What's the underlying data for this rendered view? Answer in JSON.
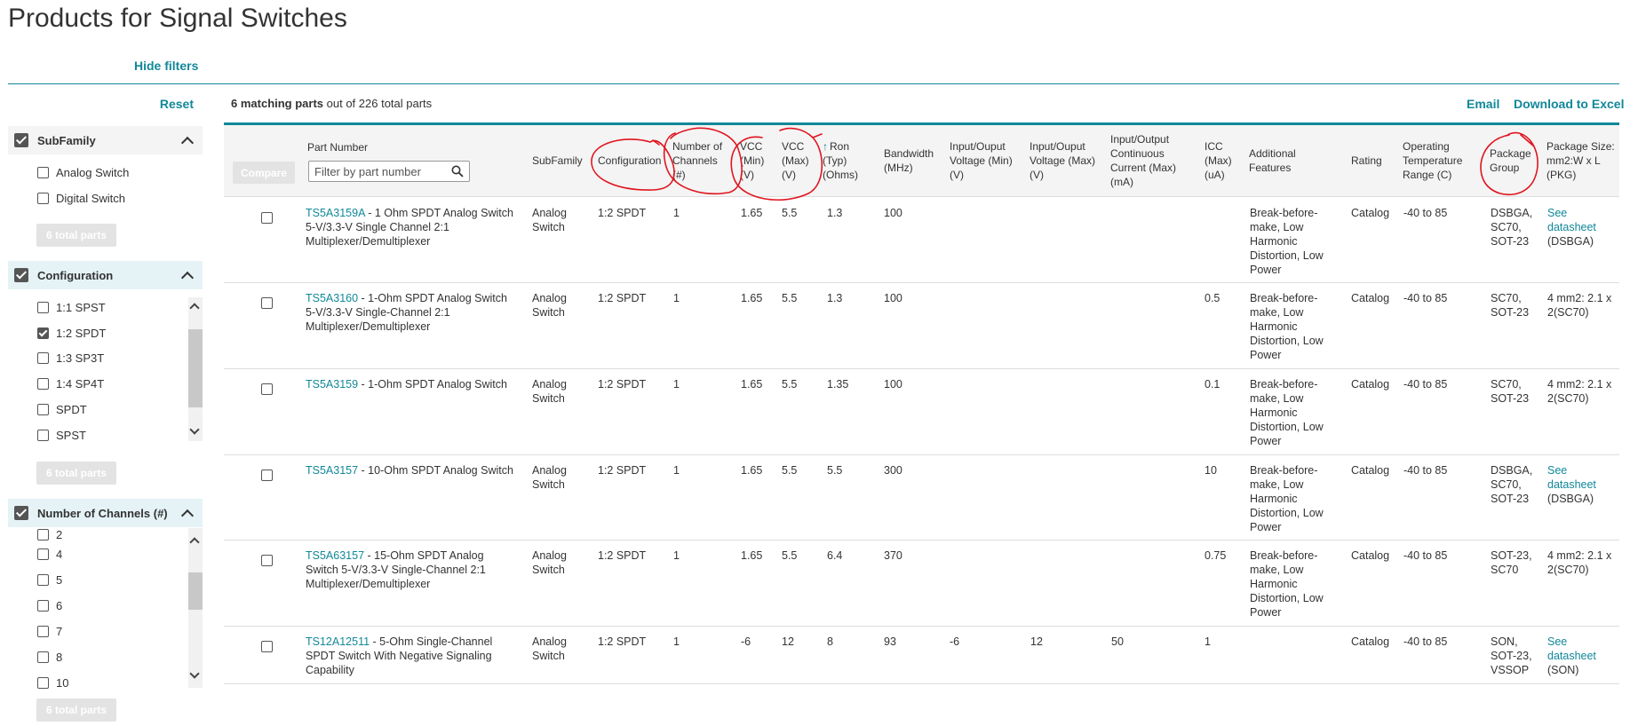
{
  "page": {
    "title": "Products for Signal Switches",
    "hide_filters": "Hide filters"
  },
  "sidebar": {
    "reset": "Reset",
    "total_parts": "6 total parts",
    "facets": [
      {
        "title": "SubFamily",
        "options": [
          {
            "label": "Analog Switch",
            "checked": false
          },
          {
            "label": "Digital Switch",
            "checked": false
          }
        ]
      },
      {
        "title": "Configuration",
        "options": [
          {
            "label": "1:1 SPST",
            "checked": false
          },
          {
            "label": "1:2 SPDT",
            "checked": true
          },
          {
            "label": "1:3 SP3T",
            "checked": false
          },
          {
            "label": "1:4 SP4T",
            "checked": false
          },
          {
            "label": "SPDT",
            "checked": false
          },
          {
            "label": "SPST",
            "checked": false
          }
        ]
      },
      {
        "title": "Number of Channels (#)",
        "options": [
          {
            "label": "2",
            "checked": false
          },
          {
            "label": "4",
            "checked": false
          },
          {
            "label": "5",
            "checked": false
          },
          {
            "label": "6",
            "checked": false
          },
          {
            "label": "7",
            "checked": false
          },
          {
            "label": "8",
            "checked": false
          },
          {
            "label": "10",
            "checked": false
          }
        ]
      }
    ]
  },
  "results": {
    "matching_bold": "6 matching parts",
    "matching_rest": " out of 226 total parts",
    "email": "Email",
    "download": "Download to Excel",
    "compare": "Compare",
    "filter_placeholder": "Filter by part number"
  },
  "table": {
    "headers": {
      "part_number": "Part Number",
      "subfamily": "SubFamily",
      "configuration": "Configuration",
      "channels": "Number of Channels (#)",
      "vcc_min": "VCC (Min) (V)",
      "vcc_max": "VCC (Max) (V)",
      "ron": "Ron (Typ) (Ohms)",
      "bandwidth": "Bandwidth (MHz)",
      "io_vmin": "Input/Ouput Voltage (Min) (V)",
      "io_vmax": "Input/Ouput Voltage (Max) (V)",
      "io_current": "Input/Output Continuous Current (Max) (mA)",
      "icc": "ICC (Max) (uA)",
      "features": "Additional Features",
      "rating": "Rating",
      "temp": "Operating Temperature Range (C)",
      "package_group": "Package Group",
      "package_size": "Package Size: mm2:W x L (PKG)"
    },
    "rows": [
      {
        "part": "TS5A3159A",
        "desc": " - 1 Ohm SPDT Analog Switch 5-V/3.3-V Single Channel 2:1 Multiplexer/Demultiplexer",
        "subfamily": "Analog Switch",
        "config": "1:2 SPDT",
        "channels": "1",
        "vcc_min": "1.65",
        "vcc_max": "5.5",
        "ron": "1.3",
        "bw": "100",
        "io_vmin": "",
        "io_vmax": "",
        "io_cur": "",
        "icc": "",
        "features": "Break-before-make, Low Harmonic Distortion, Low Power",
        "rating": "Catalog",
        "temp": "-40 to 85",
        "pkg_group": "DSBGA, SC70, SOT-23",
        "pkg_size_link": "See datasheet",
        "pkg_size_text": "(DSBGA)"
      },
      {
        "part": "TS5A3160",
        "desc": " - 1-Ohm SPDT Analog Switch 5-V/3.3-V Single-Channel 2:1 Multiplexer/Demultiplexer",
        "subfamily": "Analog Switch",
        "config": "1:2 SPDT",
        "channels": "1",
        "vcc_min": "1.65",
        "vcc_max": "5.5",
        "ron": "1.3",
        "bw": "100",
        "io_vmin": "",
        "io_vmax": "",
        "io_cur": "",
        "icc": "0.5",
        "features": "Break-before-make, Low Harmonic Distortion, Low Power",
        "rating": "Catalog",
        "temp": "-40 to 85",
        "pkg_group": "SC70, SOT-23",
        "pkg_size_link": "",
        "pkg_size_text": "4 mm2: 2.1 x 2(SC70)"
      },
      {
        "part": "TS5A3159",
        "desc": " - 1-Ohm SPDT Analog Switch",
        "subfamily": "Analog Switch",
        "config": "1:2 SPDT",
        "channels": "1",
        "vcc_min": "1.65",
        "vcc_max": "5.5",
        "ron": "1.35",
        "bw": "100",
        "io_vmin": "",
        "io_vmax": "",
        "io_cur": "",
        "icc": "0.1",
        "features": "Break-before-make, Low Harmonic Distortion, Low Power",
        "rating": "Catalog",
        "temp": "-40 to 85",
        "pkg_group": "SC70, SOT-23",
        "pkg_size_link": "",
        "pkg_size_text": "4 mm2: 2.1 x 2(SC70)"
      },
      {
        "part": "TS5A3157",
        "desc": " - 10-Ohm SPDT Analog Switch",
        "subfamily": "Analog Switch",
        "config": "1:2 SPDT",
        "channels": "1",
        "vcc_min": "1.65",
        "vcc_max": "5.5",
        "ron": "5.5",
        "bw": "300",
        "io_vmin": "",
        "io_vmax": "",
        "io_cur": "",
        "icc": "10",
        "features": "Break-before-make, Low Harmonic Distortion, Low Power",
        "rating": "Catalog",
        "temp": "-40 to 85",
        "pkg_group": "DSBGA, SC70, SOT-23",
        "pkg_size_link": "See datasheet",
        "pkg_size_text": "(DSBGA)"
      },
      {
        "part": "TS5A63157",
        "desc": " - 15-Ohm SPDT Analog Switch 5-V/3.3-V Single-Channel 2:1 Multiplexer/Demultiplexer",
        "subfamily": "Analog Switch",
        "config": "1:2 SPDT",
        "channels": "1",
        "vcc_min": "1.65",
        "vcc_max": "5.5",
        "ron": "6.4",
        "bw": "370",
        "io_vmin": "",
        "io_vmax": "",
        "io_cur": "",
        "icc": "0.75",
        "features": "Break-before-make, Low Harmonic Distortion, Low Power",
        "rating": "Catalog",
        "temp": "-40 to 85",
        "pkg_group": "SOT-23, SC70",
        "pkg_size_link": "",
        "pkg_size_text": "4 mm2: 2.1 x 2(SC70)"
      },
      {
        "part": "TS12A12511",
        "desc": " - 5-Ohm Single-Channel SPDT Switch With Negative Signaling Capability",
        "subfamily": "Analog Switch",
        "config": "1:2 SPDT",
        "channels": "1",
        "vcc_min": "-6",
        "vcc_max": "12",
        "ron": "8",
        "bw": "93",
        "io_vmin": "-6",
        "io_vmax": "12",
        "io_cur": "50",
        "icc": "1",
        "features": "",
        "rating": "Catalog",
        "temp": "-40 to 85",
        "pkg_group": "SON, SOT-23, VSSOP",
        "pkg_size_link": "See datasheet",
        "pkg_size_text": "(SON)"
      }
    ]
  },
  "colors": {
    "accent": "#118899",
    "annotation": "#e0141e"
  }
}
